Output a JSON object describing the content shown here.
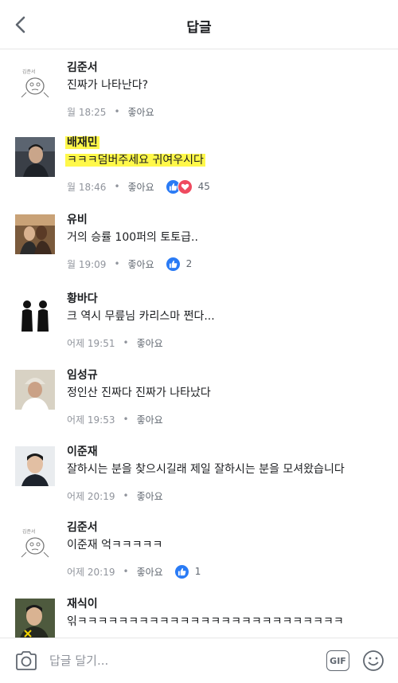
{
  "header": {
    "title": "답글"
  },
  "comments": [
    {
      "name": "김준서",
      "text": "진짜가 나타난다?",
      "time": "월 18:25",
      "like_label": "좋아요",
      "avatar_caption": "김준서",
      "reaction_count": ""
    },
    {
      "name": "배재민",
      "text": "ㅋㅋㅋ덤버주세요 귀여우시다",
      "time": "월 18:46",
      "like_label": "좋아요",
      "reaction_count": "45",
      "highlighted": true
    },
    {
      "name": "유비",
      "text": "거의 승률 100퍼의 토토급..",
      "time": "월 19:09",
      "like_label": "좋아요",
      "reaction_count": "2"
    },
    {
      "name": "황바다",
      "text": "크 역시 무릎님 카리스마 쩐다...",
      "time": "어제 19:51",
      "like_label": "좋아요",
      "reaction_count": ""
    },
    {
      "name": "임성규",
      "text": "정인산 진짜다 진짜가 나타났다",
      "time": "어제 19:53",
      "like_label": "좋아요",
      "reaction_count": ""
    },
    {
      "name": "이준재",
      "text": "잘하시는 분을 찾으시길래 제일 잘하시는 분을 모셔왔습니다",
      "time": "어제 20:19",
      "like_label": "좋아요",
      "reaction_count": ""
    },
    {
      "name": "김준서",
      "text": "이준재 억ㅋㅋㅋㅋㅋ",
      "time": "어제 20:19",
      "like_label": "좋아요",
      "reaction_count": "1",
      "avatar_caption": "김준서"
    },
    {
      "name": "재식이",
      "text": "읶ㅋㅋㅋㅋㅋㅋㅋㅋㅋㅋㅋㅋㅋㅋㅋㅋㅋㅋㅋㅋㅋㅋㅋㅋㅋㅋ",
      "time": "",
      "like_label": "",
      "reaction_count": ""
    }
  ],
  "composer": {
    "placeholder": "답글 달기...",
    "gif_label": "GIF"
  },
  "colors": {
    "highlight": "#fff84a",
    "like_blue": "#2a7bf5",
    "love_red": "#ef4a5f",
    "meta_gray": "#90949c"
  },
  "icons": [
    "back-chevron-icon",
    "like-reaction-icon",
    "love-reaction-icon",
    "camera-icon",
    "gif-icon",
    "emoji-smiley-icon"
  ]
}
